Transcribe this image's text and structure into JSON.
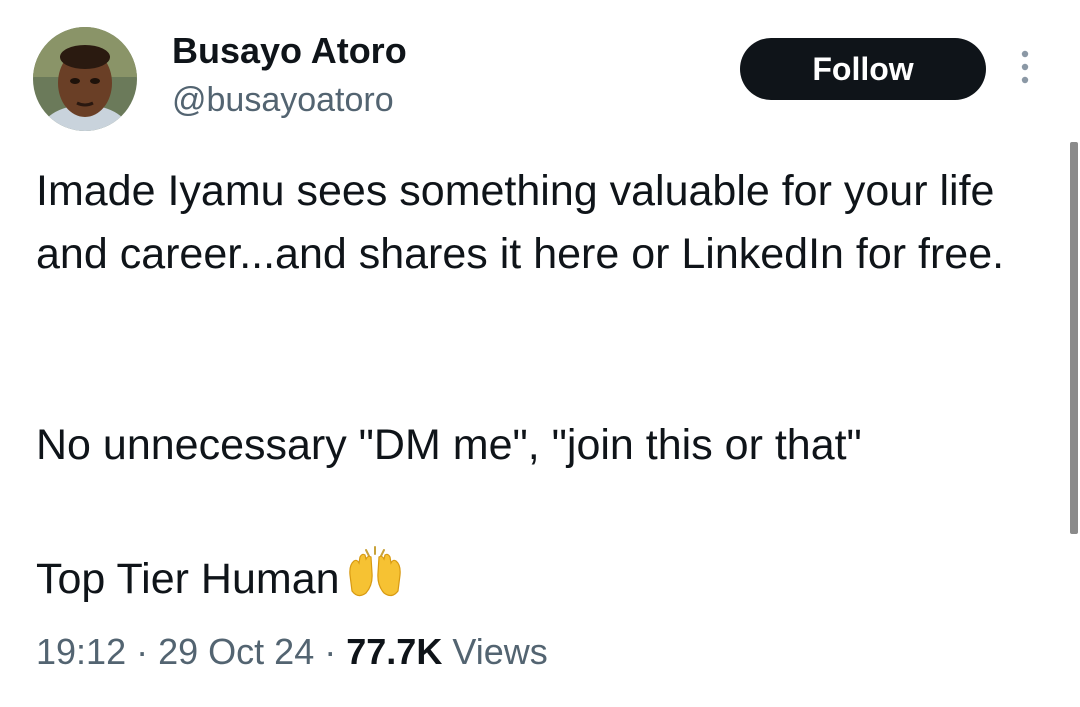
{
  "author": {
    "display_name": "Busayo Atoro",
    "handle": "@busayoatoro"
  },
  "actions": {
    "follow_label": "Follow",
    "more_icon": "more-vertical-icon"
  },
  "tweet": {
    "paragraph_1": "Imade Iyamu sees something valuable for your life and career...and shares it here or LinkedIn for free.",
    "paragraph_2": "No unnecessary \"DM me\", \"join this or that\"",
    "paragraph_3": "Top Tier Human",
    "emoji": "raising-hands-emoji"
  },
  "meta": {
    "time": "19:12",
    "separator": "·",
    "date": "29 Oct 24",
    "views_count": "77.7K",
    "views_label": "Views"
  },
  "colors": {
    "primary_text": "#0f1419",
    "secondary_text": "#536471",
    "button_bg": "#0f1419",
    "button_text": "#ffffff"
  }
}
